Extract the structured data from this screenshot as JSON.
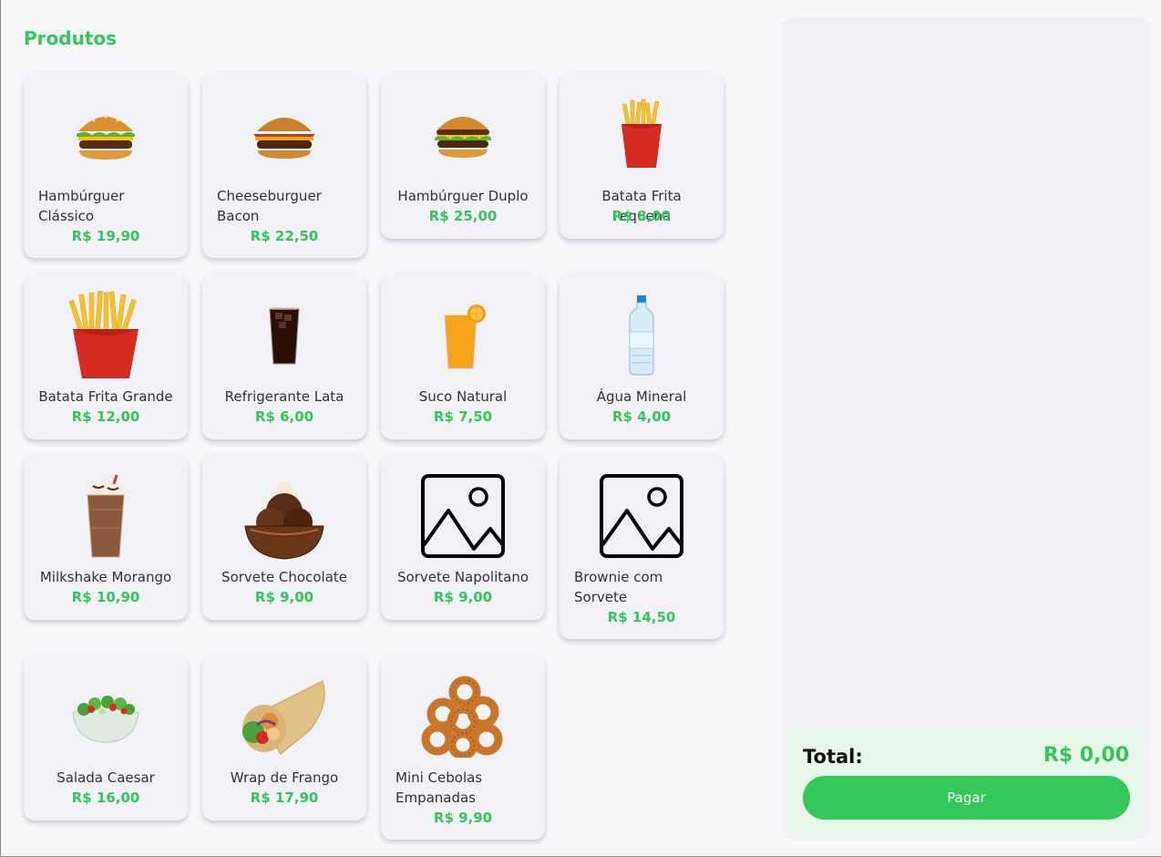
{
  "page": {
    "title": "Produtos"
  },
  "products": [
    {
      "name": "Hambúrguer Clássico",
      "price": "R$ 19,90",
      "icon": "burger-icon"
    },
    {
      "name": "Cheeseburguer Bacon",
      "price": "R$ 22,50",
      "icon": "burger-icon"
    },
    {
      "name": "Hambúrguer Duplo",
      "price": "R$ 25,00",
      "icon": "burger-icon"
    },
    {
      "name": "Batata Frita Pequena",
      "price": "R$ 8,00",
      "icon": "fries-icon"
    },
    {
      "name": "Batata Frita Grande",
      "price": "R$ 12,00",
      "icon": "fries-icon"
    },
    {
      "name": "Refrigerante Lata",
      "price": "R$ 6,00",
      "icon": "soda-glass-icon"
    },
    {
      "name": "Suco Natural",
      "price": "R$ 7,50",
      "icon": "juice-glass-icon"
    },
    {
      "name": "Água Mineral",
      "price": "R$ 4,00",
      "icon": "water-bottle-icon"
    },
    {
      "name": "Milkshake Morango",
      "price": "R$ 10,90",
      "icon": "milkshake-icon"
    },
    {
      "name": "Sorvete Chocolate",
      "price": "R$ 9,00",
      "icon": "ice-cream-bowl-icon"
    },
    {
      "name": "Sorvete Napolitano",
      "price": "R$ 9,00",
      "icon": "image-placeholder-icon"
    },
    {
      "name": "Brownie com Sorvete",
      "price": "R$ 14,50",
      "icon": "image-placeholder-icon"
    },
    {
      "name": "Salada Caesar",
      "price": "R$ 16,00",
      "icon": "salad-bowl-icon"
    },
    {
      "name": "Wrap de Frango",
      "price": "R$ 17,90",
      "icon": "wrap-icon"
    },
    {
      "name": "Mini Cebolas Empanadas",
      "price": "R$ 9,90",
      "icon": "onion-rings-icon"
    }
  ],
  "cart": {
    "total_label": "Total:",
    "total_value": "R$ 0,00",
    "pay_label": "Pagar"
  },
  "colors": {
    "accent": "#34c759",
    "card": "#f2f1f6",
    "panel": "#f1f0f5",
    "total_bg": "#e7f7ea"
  }
}
